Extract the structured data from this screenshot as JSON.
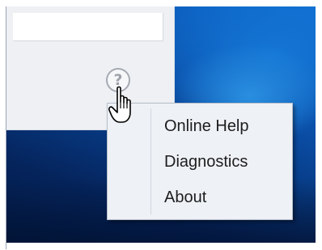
{
  "help": {
    "icon_glyph": "?",
    "icon": "help-circle-icon"
  },
  "cursor": {
    "icon": "hand-pointer-icon"
  },
  "context_menu": {
    "items": [
      {
        "label": "Online Help"
      },
      {
        "label": "Diagnostics"
      },
      {
        "label": "About"
      }
    ]
  },
  "colors": {
    "desktop_blue": "#0f6fd3",
    "desktop_dark": "#05245c",
    "window_bg": "#eef0f4",
    "menu_bg": "#eef1f6",
    "menu_text": "#1d1d1d",
    "icon_grey": "#a6abb3"
  }
}
